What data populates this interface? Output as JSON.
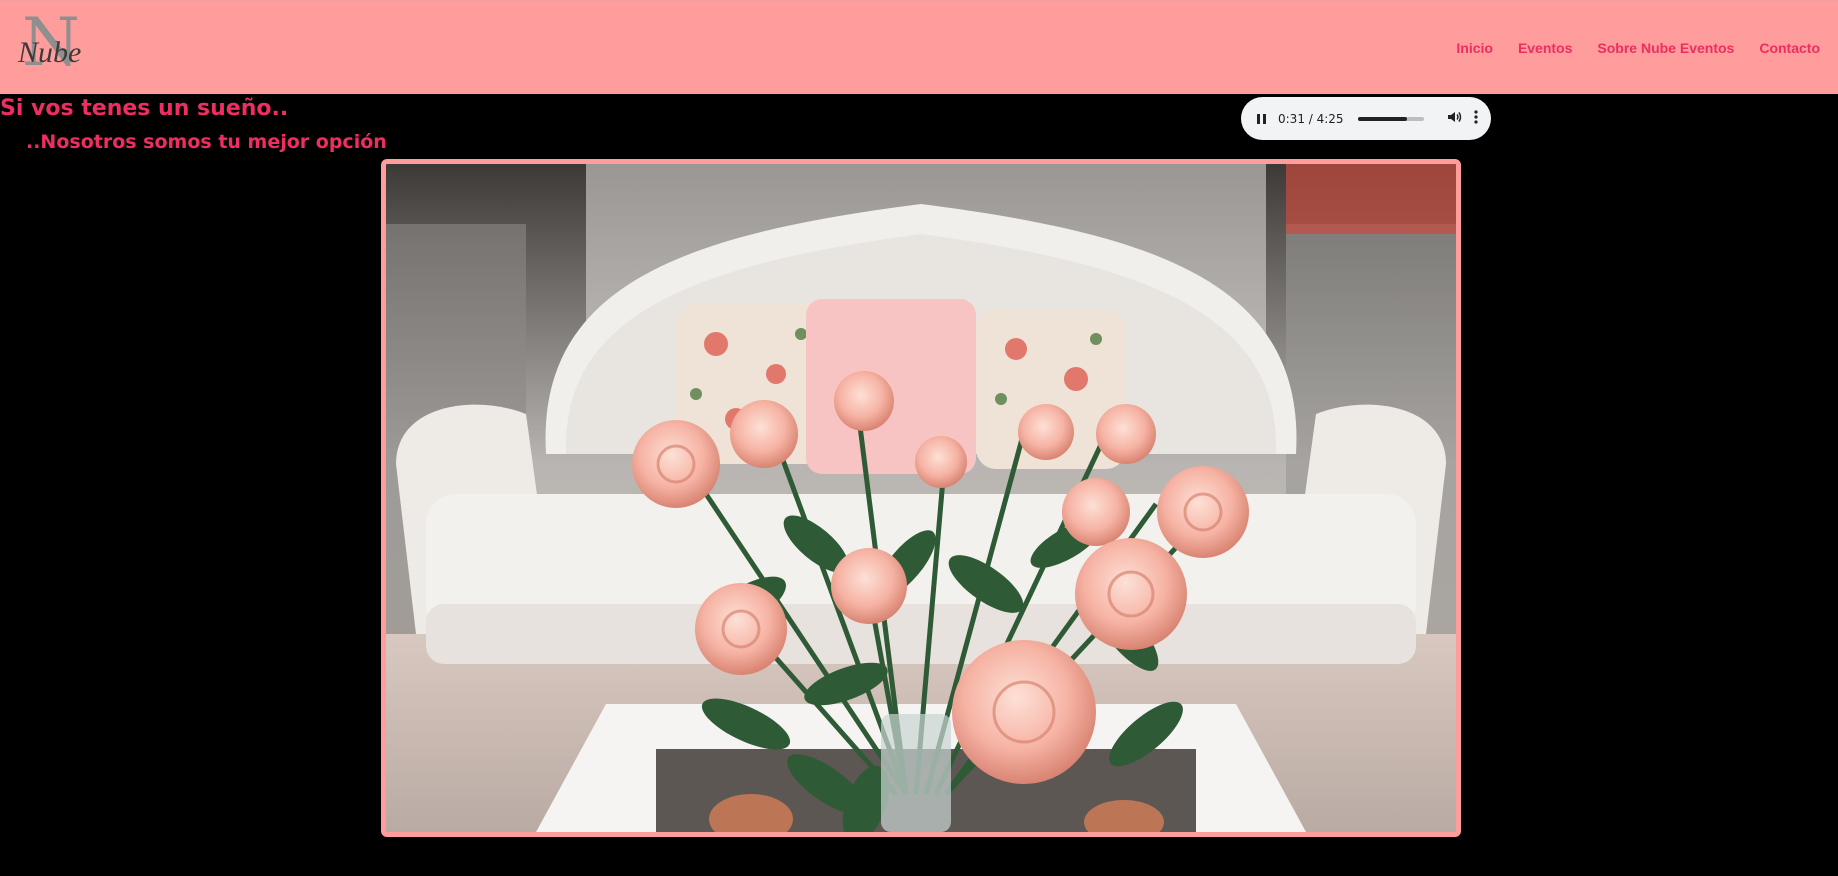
{
  "brand": {
    "logo_letter": "N",
    "logo_script": "Nube"
  },
  "nav": {
    "items": [
      {
        "label": "Inicio"
      },
      {
        "label": "Eventos"
      },
      {
        "label": "Sobre Nube Eventos"
      },
      {
        "label": "Contacto"
      }
    ]
  },
  "hero": {
    "headline": "Si vos tenes un sueño..",
    "subline": "..Nosotros somos tu mejor opción"
  },
  "audio_player": {
    "time_display": "0:31 / 4:25",
    "progress_fraction": 0.12,
    "volume_fraction": 0.75,
    "state": "playing"
  },
  "colors": {
    "header_bg": "#ff9c9c",
    "accent_text": "#ef2d60",
    "page_bg": "#000000",
    "frame_border": "#ff9c9c"
  },
  "icons": [
    "pause-icon",
    "volume-icon",
    "more-options-icon"
  ]
}
